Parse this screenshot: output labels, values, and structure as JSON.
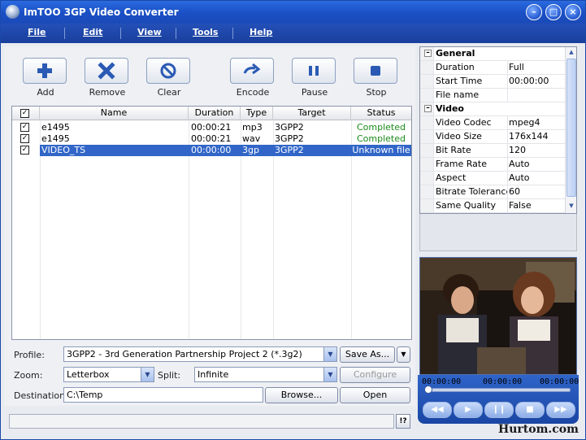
{
  "window": {
    "title": "ImTOO 3GP Video Converter"
  },
  "menu": [
    "File",
    "Edit",
    "View",
    "Tools",
    "Help"
  ],
  "toolbar": {
    "add": "Add",
    "remove": "Remove",
    "clear": "Clear",
    "encode": "Encode",
    "pause": "Pause",
    "stop": "Stop"
  },
  "grid": {
    "columns": [
      "Name",
      "Duration",
      "Type",
      "Target",
      "Status"
    ],
    "rows": [
      {
        "name": "e1495",
        "duration": "00:00:21",
        "type": "mp3",
        "target": "3GPP2",
        "status": "Completed"
      },
      {
        "name": "e1495",
        "duration": "00:00:21",
        "type": "wav",
        "target": "3GPP2",
        "status": "Completed"
      },
      {
        "name": "VIDEO_TS",
        "duration": "00:00:00",
        "type": "3gp",
        "target": "3GPP2",
        "status": "Unknown file"
      }
    ]
  },
  "form": {
    "profile_label": "Profile:",
    "profile_value": "3GPP2 - 3rd Generation Partnership Project 2  (*.3g2)",
    "save_as": "Save As...",
    "zoom_label": "Zoom:",
    "zoom_value": "Letterbox",
    "split_label": "Split:",
    "split_value": "Infinite",
    "configure": "Configure",
    "destination_label": "Destination:",
    "destination_value": "C:\\Temp",
    "browse": "Browse...",
    "open": "Open",
    "help": "!?"
  },
  "properties": {
    "groups": [
      {
        "name": "General",
        "items": [
          {
            "key": "Duration",
            "value": "Full"
          },
          {
            "key": "Start Time",
            "value": "00:00:00"
          },
          {
            "key": "File name",
            "value": ""
          }
        ]
      },
      {
        "name": "Video",
        "items": [
          {
            "key": "Video Codec",
            "value": "mpeg4"
          },
          {
            "key": "Video Size",
            "value": "176x144"
          },
          {
            "key": "Bit Rate",
            "value": "120"
          },
          {
            "key": "Frame Rate",
            "value": "Auto"
          },
          {
            "key": "Aspect",
            "value": "Auto"
          },
          {
            "key": "Bitrate Tolerance",
            "value": "60"
          },
          {
            "key": "Same Quality",
            "value": "False"
          }
        ]
      }
    ]
  },
  "player": {
    "time_start": "00:00:00",
    "time_mid": "00:00:00",
    "time_end": "00:00:00"
  },
  "watermark": "Hurtom.com"
}
